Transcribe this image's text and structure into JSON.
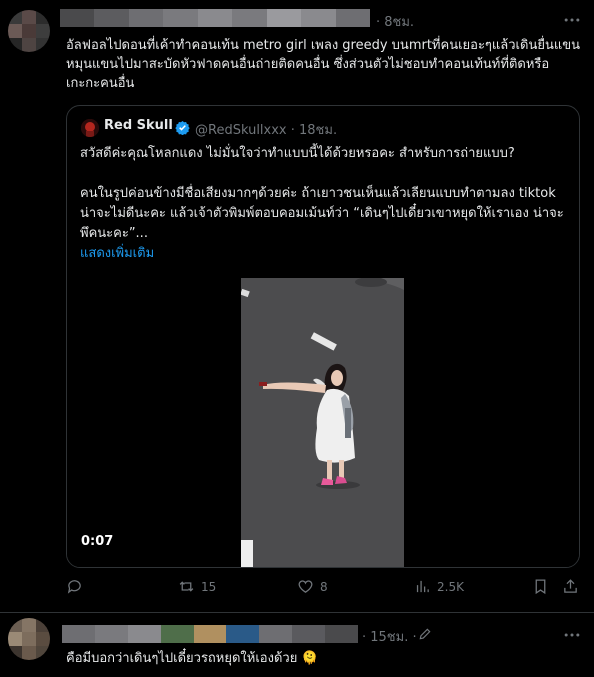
{
  "post": {
    "time": "· 8ชม.",
    "text": "อัลฟอลไปดอนที่เค้าทำคอนเท้น metro girl เพลง greedy บนmrtที่คนเยอะๆแล้วเดินยื่นแขนหมุนแขนไปมาสะบัดหัวฟาดคนอื่นถ่ายติดคนอื่น ซึ่งส่วนตัวไม่ชอบทำคอนเท้นท์ที่ติดหรือเกะกะคนอื่น",
    "quote": {
      "name": "Red Skull",
      "handle": "@RedSkullxxx · 18ชม.",
      "text": "สวัสดีค่ะคุณโหลกแดง ไม่มั่นใจว่าทำแบบนี้ได้ด้วยหรอคะ สำหรับการถ่ายแบบ?\n\nคนในรูปค่อนข้างมีชื่อเสียงมากๆด้วยค่ะ ถ้าเยาวชนเห็นแล้วเลียนแบบทำตามลง tiktok น่าจะไม่ดีนะคะ แล้วเจ้าตัวพิมพ์ตอบคอมเม้นท์ว่า “เดินๆไปเดี๋ยวเขาหยุดให้เราเอง น่าจะพึคนะคะ”...",
      "show_more": "แสดงเพิ่มเติม",
      "video_duration": "0:07"
    },
    "actions": {
      "reply": "",
      "retweet": "15",
      "like": "8",
      "views": "2.5K"
    }
  },
  "reply": {
    "time": "· 15ชม. ·",
    "text": "คือมีบอกว่าเดินๆไปเดี๋ยวรถหยุดให้เองด้วย 🫠"
  },
  "colors": {
    "background": "#000000",
    "text": "#e7e9ea",
    "muted": "#71767b",
    "link": "#1d9bf0",
    "border": "#2f3336"
  },
  "icons": [
    "more-icon",
    "verified-badge-icon",
    "reply-icon",
    "retweet-icon",
    "like-icon",
    "views-icon",
    "bookmark-icon",
    "share-icon",
    "edit-icon"
  ]
}
